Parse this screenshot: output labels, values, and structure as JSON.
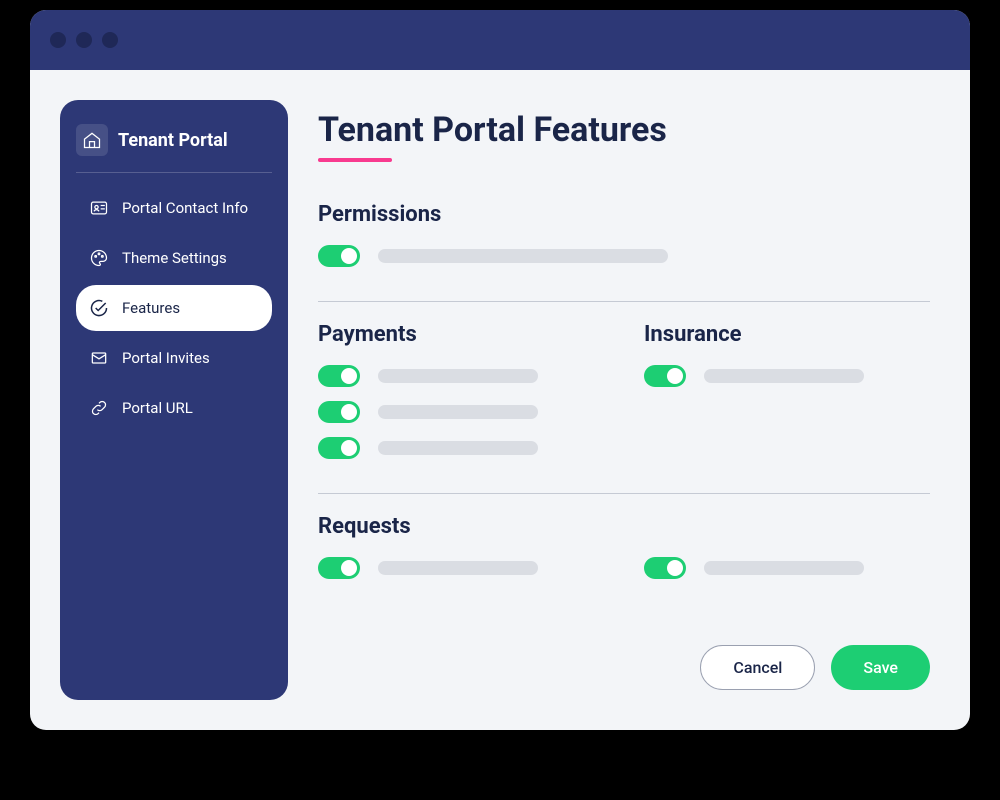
{
  "sidebar": {
    "title": "Tenant Portal",
    "items": [
      {
        "label": "Portal Contact Info",
        "active": false
      },
      {
        "label": "Theme Settings",
        "active": false
      },
      {
        "label": "Features",
        "active": true
      },
      {
        "label": "Portal Invites",
        "active": false
      },
      {
        "label": "Portal URL",
        "active": false
      }
    ]
  },
  "page": {
    "title": "Tenant Portal Features"
  },
  "sections": {
    "permissions": {
      "title": "Permissions",
      "toggles": [
        {
          "enabled": true
        }
      ]
    },
    "payments": {
      "title": "Payments",
      "toggles": [
        {
          "enabled": true
        },
        {
          "enabled": true
        },
        {
          "enabled": true
        }
      ]
    },
    "insurance": {
      "title": "Insurance",
      "toggles": [
        {
          "enabled": true
        }
      ]
    },
    "requests": {
      "title": "Requests",
      "toggles": [
        {
          "enabled": true
        },
        {
          "enabled": true
        }
      ]
    }
  },
  "actions": {
    "cancel_label": "Cancel",
    "save_label": "Save"
  },
  "colors": {
    "primary_navy": "#2d3876",
    "accent_pink": "#f83a8f",
    "toggle_green": "#1dce73",
    "background": "#f3f5f8"
  }
}
